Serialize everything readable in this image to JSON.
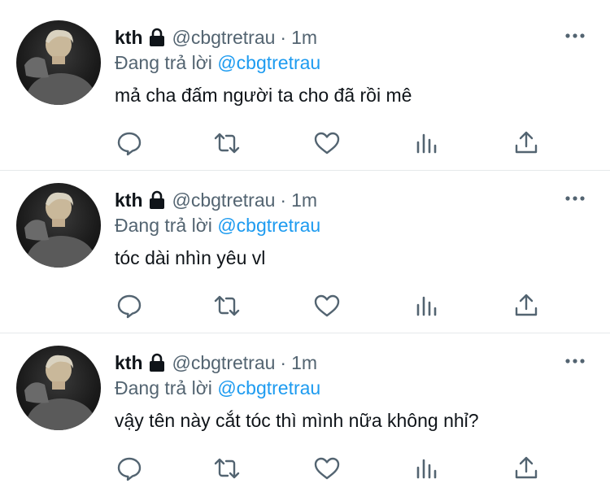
{
  "tweets": [
    {
      "name": "kth",
      "handle": "@cbgtretrau",
      "separator": "·",
      "time": "1m",
      "reply_prefix": "Đang trả lời",
      "reply_to": "@cbgtretrau",
      "text": "mả cha đấm người ta cho đã rồi mê"
    },
    {
      "name": "kth",
      "handle": "@cbgtretrau",
      "separator": "·",
      "time": "1m",
      "reply_prefix": "Đang trả lời",
      "reply_to": "@cbgtretrau",
      "text": "tóc dài nhìn yêu vl"
    },
    {
      "name": "kth",
      "handle": "@cbgtretrau",
      "separator": "·",
      "time": "1m",
      "reply_prefix": "Đang trả lời",
      "reply_to": "@cbgtretrau",
      "text": "vậy tên này cắt tóc thì mình nữa không nhỉ?"
    }
  ],
  "icons": {
    "lock": "lock-icon",
    "more": "more-icon",
    "reply": "reply-icon",
    "retweet": "retweet-icon",
    "like": "like-icon",
    "views": "views-icon",
    "share": "share-icon"
  },
  "colors": {
    "text_primary": "#0f1419",
    "text_secondary": "#536471",
    "mention": "#1d9bf0",
    "separator": "#e6e9eb"
  }
}
